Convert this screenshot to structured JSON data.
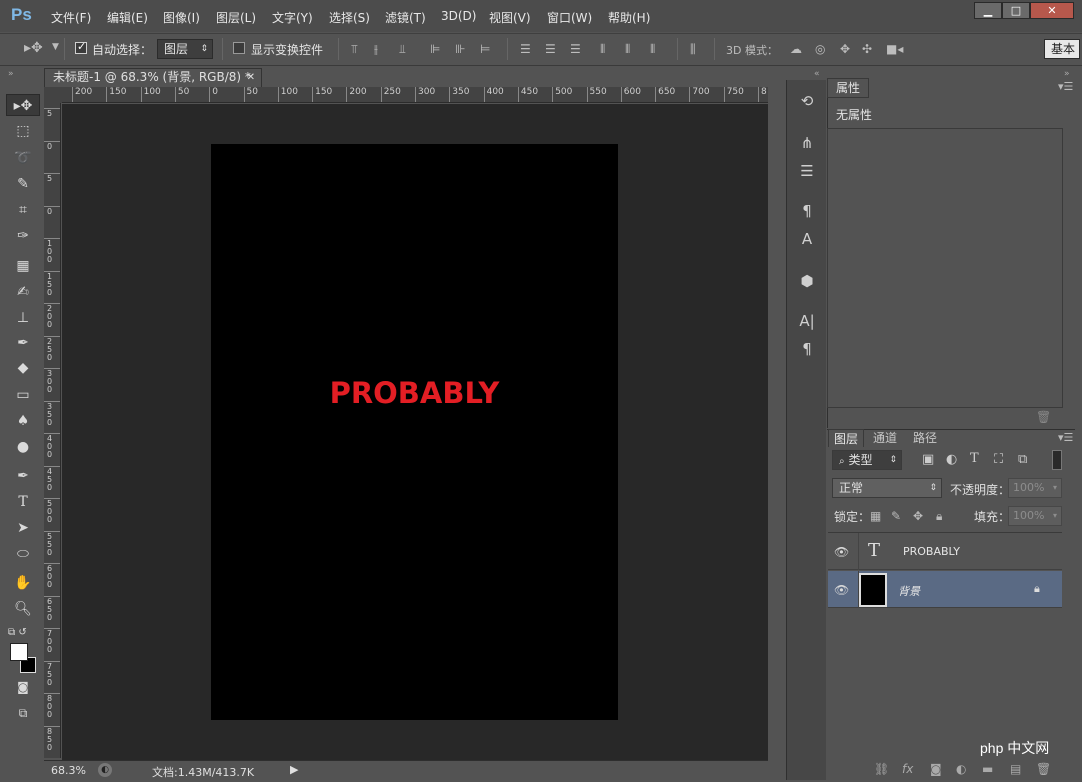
{
  "app": {
    "logo": "Ps"
  },
  "menu": [
    "文件(F)",
    "编辑(E)",
    "图像(I)",
    "图层(L)",
    "文字(Y)",
    "选择(S)",
    "滤镜(T)",
    "3D(D)",
    "视图(V)",
    "窗口(W)",
    "帮助(H)"
  ],
  "window_controls": {
    "minimize": "▁",
    "restore": "□",
    "close": "✕"
  },
  "options": {
    "auto_select_label": "自动选择：",
    "auto_select_checked": true,
    "auto_select_value": "图层",
    "show_transform_label": "显示变换控件",
    "mode_3d_label": "3D 模式：",
    "workspace": "基本"
  },
  "document": {
    "tab_title": "未标题-1 @ 68.3% (背景, RGB/8) *",
    "canvas_text": "PROBABLY",
    "canvas_text_color": "#e31e24"
  },
  "ruler": {
    "h_ticks": [
      "200",
      "150",
      "100",
      "50",
      "0",
      "50",
      "100",
      "150",
      "200",
      "250",
      "300",
      "350",
      "400",
      "450",
      "500",
      "550",
      "600",
      "650",
      "700",
      "750",
      "8"
    ],
    "v_ticks": [
      "5",
      "0",
      "5",
      "0",
      "1 0 0",
      "1 5 0",
      "2 0 0",
      "2 5 0",
      "3 0 0",
      "3 5 0",
      "4 0 0",
      "4 5 0",
      "5 0 0",
      "5 5 0",
      "6 0 0",
      "6 5 0",
      "7 0 0",
      "7 5 0",
      "8 0 0",
      "8 5 0"
    ]
  },
  "status": {
    "zoom": "68.3%",
    "doc_info": "文档:1.43M/413.7K"
  },
  "properties": {
    "tab": "属性",
    "content": "无属性"
  },
  "layers_panel": {
    "tabs": [
      "图层",
      "通道",
      "路径"
    ],
    "filter": "类型",
    "blend_mode": "正常",
    "opacity_label": "不透明度：",
    "opacity_value": "100%",
    "lock_label": "锁定：",
    "fill_label": "填充：",
    "fill_value": "100%",
    "layers": [
      {
        "name": "PROBABLY",
        "kind": "text",
        "selected": false
      },
      {
        "name": "背景",
        "kind": "background",
        "selected": true,
        "locked": true
      }
    ]
  },
  "watermark": "php 中文网"
}
